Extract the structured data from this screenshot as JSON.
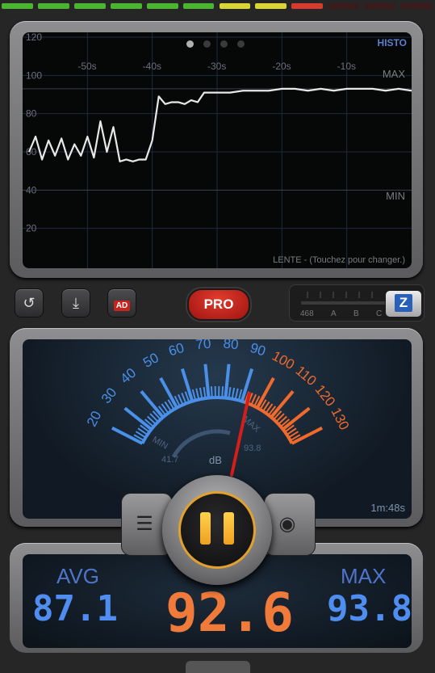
{
  "level_bar": {
    "segments": [
      {
        "color": "#4ab52e"
      },
      {
        "color": "#4ab52e"
      },
      {
        "color": "#4ab52e"
      },
      {
        "color": "#4ab52e"
      },
      {
        "color": "#4ab52e"
      },
      {
        "color": "#4ab52e"
      },
      {
        "color": "#d8d534"
      },
      {
        "color": "#d8d534"
      },
      {
        "color": "#d83b2e"
      },
      {
        "color": "#3a1b1b"
      },
      {
        "color": "#3a1b1b"
      },
      {
        "color": "#3a1b1b"
      }
    ],
    "lit_count": 9
  },
  "history": {
    "title": "HISTO",
    "y_labels": [
      "120",
      "100",
      "80",
      "60",
      "40",
      "20"
    ],
    "x_labels": [
      "-50s",
      "-40s",
      "-30s",
      "-20s",
      "-10s"
    ],
    "max_label": "MAX",
    "min_label": "MIN",
    "speed_hint": "LENTE - (Touchez pour changer.)",
    "pages": 4,
    "active_page": 0,
    "series": {
      "unit": "dB",
      "time_s": [
        -59,
        -58,
        -57,
        -56,
        -55,
        -54,
        -53,
        -52,
        -51,
        -50,
        -49,
        -48,
        -47,
        -46,
        -45,
        -44,
        -43,
        -42,
        -41,
        -40,
        -39,
        -38,
        -37,
        -36,
        -35,
        -34,
        -33,
        -32,
        -31,
        -30,
        -28,
        -26,
        -24,
        -22,
        -20,
        -18,
        -16,
        -14,
        -12,
        -10,
        -8,
        -6,
        -4,
        -2,
        0
      ],
      "level_db": [
        60,
        68,
        56,
        66,
        58,
        67,
        56,
        64,
        58,
        68,
        57,
        76,
        60,
        73,
        55,
        56,
        55,
        56,
        56,
        66,
        89,
        85,
        86,
        86,
        85,
        87,
        86,
        91,
        91,
        91,
        91,
        92,
        92,
        92,
        93,
        93,
        92,
        93,
        92,
        93,
        93,
        93,
        92,
        93,
        92
      ]
    }
  },
  "controls": {
    "reset_icon": "reset-icon",
    "export_icon": "download-icon",
    "ad_label": "AD",
    "pro_label": "PRO",
    "weighting_labels": [
      "468",
      "A",
      "B",
      "C"
    ],
    "weighting_selected": "Z"
  },
  "meter": {
    "scale_blue": [
      "20",
      "30",
      "40",
      "50",
      "60",
      "70",
      "80",
      "90"
    ],
    "scale_orange": [
      "100",
      "110",
      "120",
      "130"
    ],
    "unit": "dB",
    "min_label": "MIN",
    "max_label": "MAX",
    "min_value": "41.7",
    "max_value": "93.8",
    "needle_db": 92.6,
    "timer": "1m:48s",
    "colors": {
      "blue": "#4a8fe8",
      "orange": "#f06a2e",
      "needle": "#d31e1a"
    }
  },
  "stats": {
    "avg_label": "AVG",
    "max_label": "MAX",
    "avg_value": "87.1",
    "current_value": "92.6",
    "max_value": "93.8",
    "colors": {
      "avg": "#4f8ef0",
      "current": "#f07a3a",
      "max": "#4f8ef0"
    }
  },
  "buttons": {
    "left_icon": "notepad-icon",
    "center_icon": "pause-icon",
    "right_icon": "camera-icon"
  }
}
